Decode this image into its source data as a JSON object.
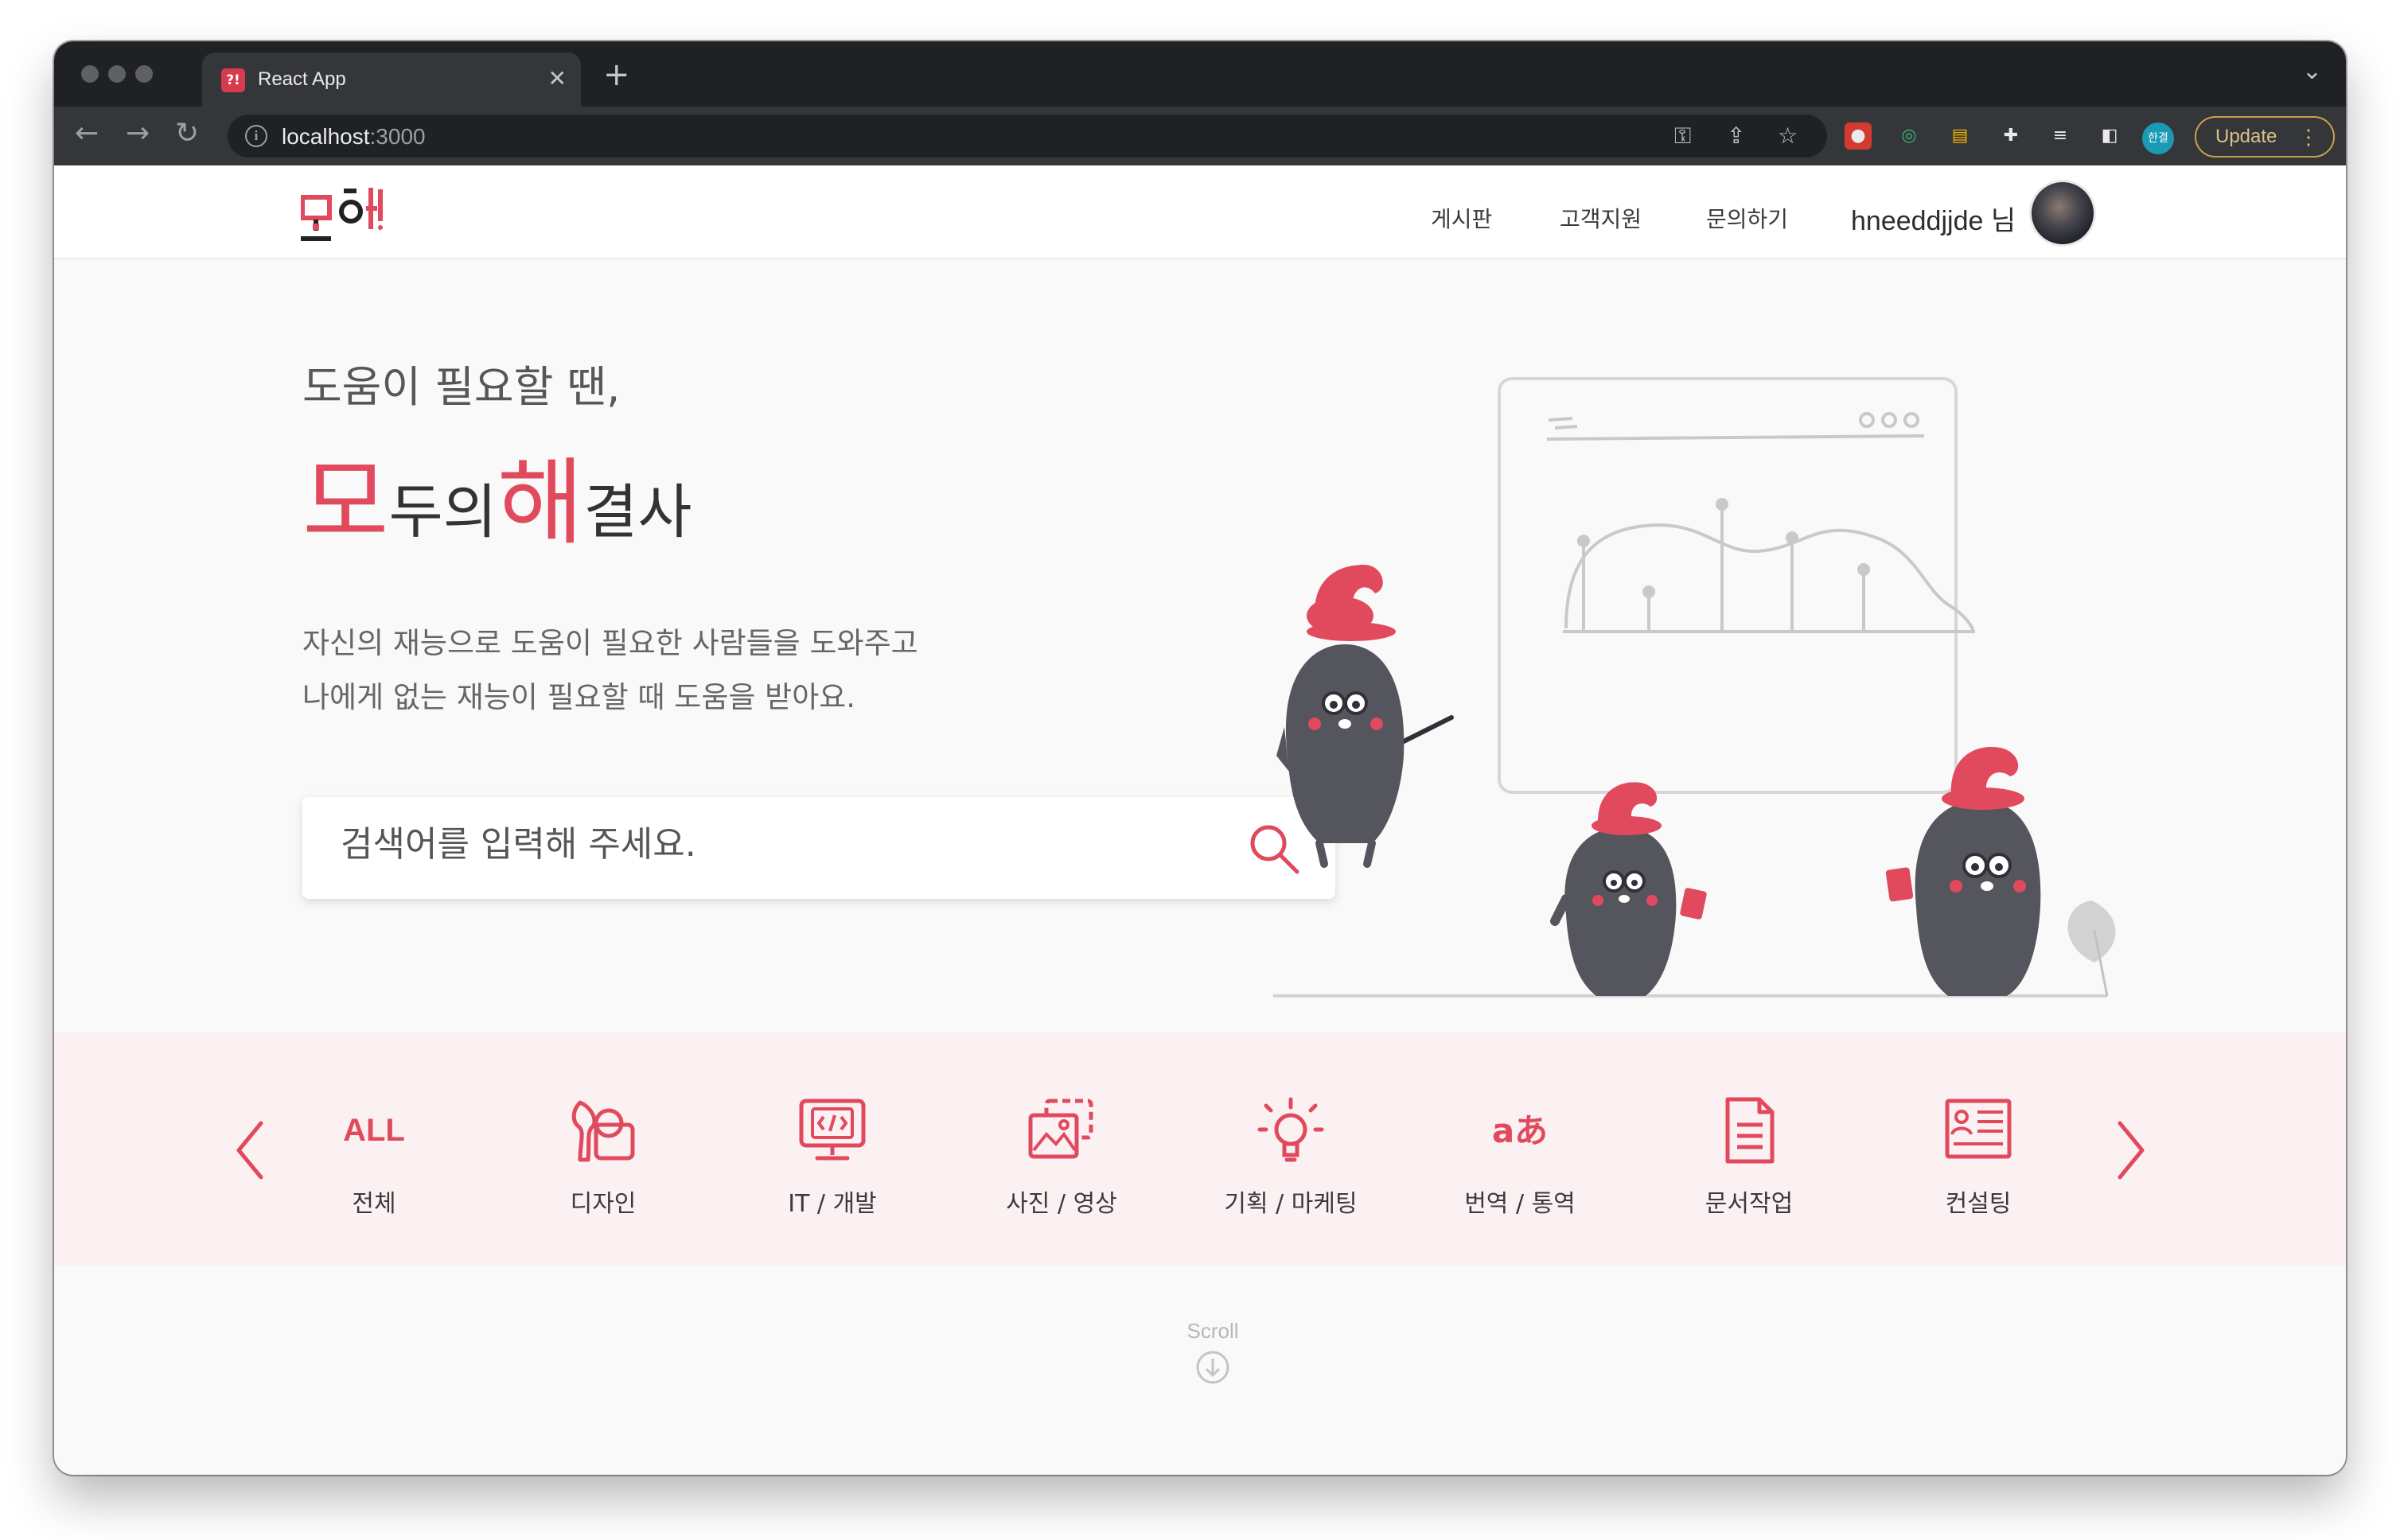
{
  "browser": {
    "tab_title": "React App",
    "tab_favicon_text": "?!",
    "url_host": "localhost",
    "url_port": ":3000",
    "profile_initial": "한결",
    "update_label": "Update"
  },
  "header": {
    "logo_text": "모해",
    "nav": [
      "게시판",
      "고객지원",
      "문의하기"
    ],
    "username": "hneeddjjde 님"
  },
  "hero": {
    "subtitle": "도움이 필요할 땐,",
    "title_parts": [
      "모",
      "두의",
      "해",
      "결사"
    ],
    "description": [
      "자신의 재능으로 도움이 필요한 사람들을 도와주고",
      "나에게 없는 재능이 필요할 때 도움을 받아요."
    ],
    "search_placeholder": "검색어를 입력해 주세요."
  },
  "categories": {
    "items": [
      {
        "label": "전체",
        "icon": "all-text-icon",
        "icon_text": "ALL"
      },
      {
        "label": "디자인",
        "icon": "design-icon"
      },
      {
        "label": "IT / 개발",
        "icon": "code-monitor-icon"
      },
      {
        "label": "사진 / 영상",
        "icon": "photo-icon"
      },
      {
        "label": "기획 / 마케팅",
        "icon": "lightbulb-icon"
      },
      {
        "label": "번역 / 통역",
        "icon": "translate-icon",
        "icon_text": "aあ"
      },
      {
        "label": "문서작업",
        "icon": "document-icon"
      },
      {
        "label": "컨설팅",
        "icon": "consulting-icon"
      }
    ]
  },
  "scroll_hint": "Scroll",
  "colors": {
    "accent": "#e14a5d",
    "band": "#fcf1f2",
    "chrome_dark": "#202124",
    "chrome_toolbar": "#35363a"
  }
}
